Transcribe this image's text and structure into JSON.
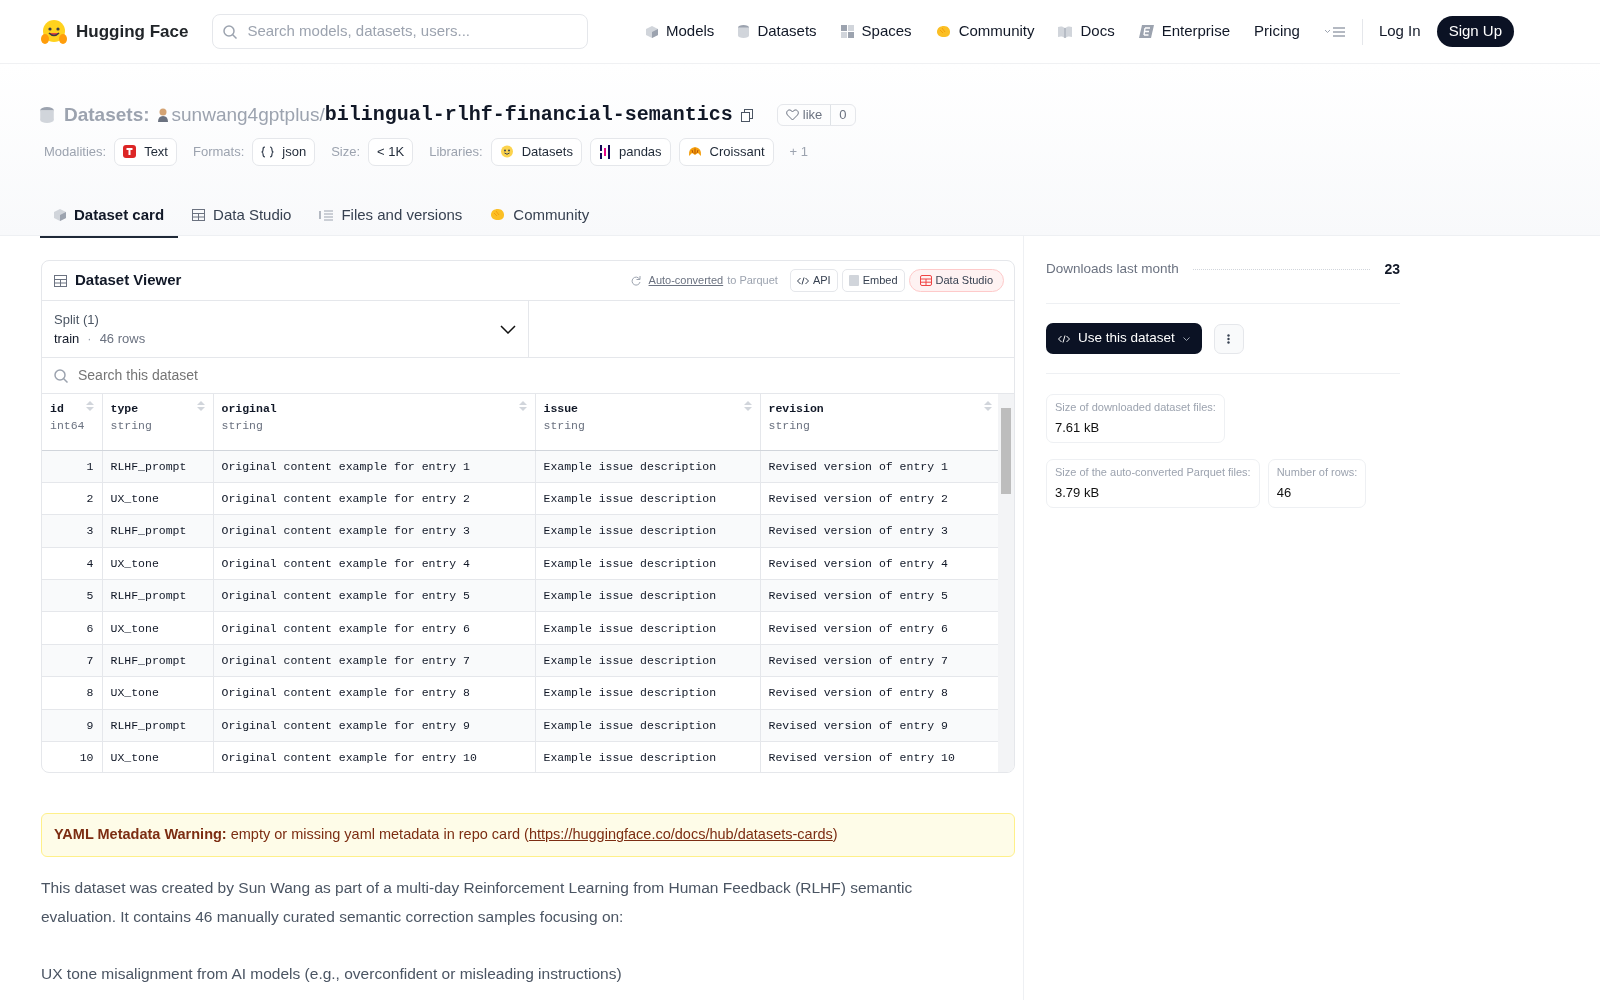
{
  "nav": {
    "brand": "Hugging Face",
    "search_placeholder": "Search models, datasets, users...",
    "links": [
      {
        "label": "Models",
        "kind": "cube"
      },
      {
        "label": "Datasets",
        "kind": "database"
      },
      {
        "label": "Spaces",
        "kind": "grid"
      },
      {
        "label": "Community",
        "kind": "hand"
      },
      {
        "label": "Docs",
        "kind": "book"
      },
      {
        "label": "Enterprise",
        "kind": "enterprise"
      },
      {
        "label": "Pricing",
        "kind": "plain"
      }
    ],
    "login": "Log In",
    "signup": "Sign Up"
  },
  "header": {
    "section": "Datasets:",
    "owner": "sunwang4gptplus",
    "separator": "/",
    "name": "bilingual-rlhf-financial-semantics",
    "like": "like",
    "likes": "0",
    "tag_groups": [
      {
        "label": "Modalities:",
        "tags": [
          {
            "text": "Text",
            "kind": "text"
          }
        ]
      },
      {
        "label": "Formats:",
        "tags": [
          {
            "text": "json",
            "kind": "braces"
          }
        ]
      },
      {
        "label": "Size:",
        "tags": [
          {
            "text": "< 1K",
            "kind": "plain"
          }
        ]
      },
      {
        "label": "Libraries:",
        "tags": [
          {
            "text": "Datasets",
            "kind": "hf"
          },
          {
            "text": "pandas",
            "kind": "pandas"
          },
          {
            "text": "Croissant",
            "kind": "croissant"
          }
        ]
      }
    ],
    "more": "+ 1"
  },
  "tabs": [
    {
      "label": "Dataset card",
      "kind": "cube",
      "selected": true
    },
    {
      "label": "Data Studio",
      "kind": "table",
      "selected": false
    },
    {
      "label": "Files and versions",
      "kind": "files",
      "selected": false
    },
    {
      "label": "Community",
      "kind": "hand",
      "selected": false
    }
  ],
  "viewer": {
    "title": "Dataset Viewer",
    "auto_link": "Auto-converted",
    "auto_rest": "to Parquet",
    "buttons": [
      {
        "label": "API",
        "kind": "api"
      },
      {
        "label": "Embed",
        "kind": "embed"
      },
      {
        "label": "Data Studio",
        "kind": "studio"
      }
    ],
    "split_label": "Split (1)",
    "split_value": "train",
    "split_dot": "·",
    "split_rows": "46 rows",
    "search_placeholder": "Search this dataset",
    "columns": [
      {
        "name": "id",
        "type": "int64"
      },
      {
        "name": "type",
        "type": "string"
      },
      {
        "name": "original",
        "type": "string"
      },
      {
        "name": "issue",
        "type": "string"
      },
      {
        "name": "revision",
        "type": "string"
      }
    ],
    "rows": [
      [
        "1",
        "RLHF_prompt",
        "Original content example for entry 1",
        "Example issue description",
        "Revised version of entry 1"
      ],
      [
        "2",
        "UX_tone",
        "Original content example for entry 2",
        "Example issue description",
        "Revised version of entry 2"
      ],
      [
        "3",
        "RLHF_prompt",
        "Original content example for entry 3",
        "Example issue description",
        "Revised version of entry 3"
      ],
      [
        "4",
        "UX_tone",
        "Original content example for entry 4",
        "Example issue description",
        "Revised version of entry 4"
      ],
      [
        "5",
        "RLHF_prompt",
        "Original content example for entry 5",
        "Example issue description",
        "Revised version of entry 5"
      ],
      [
        "6",
        "UX_tone",
        "Original content example for entry 6",
        "Example issue description",
        "Revised version of entry 6"
      ],
      [
        "7",
        "RLHF_prompt",
        "Original content example for entry 7",
        "Example issue description",
        "Revised version of entry 7"
      ],
      [
        "8",
        "UX_tone",
        "Original content example for entry 8",
        "Example issue description",
        "Revised version of entry 8"
      ],
      [
        "9",
        "RLHF_prompt",
        "Original content example for entry 9",
        "Example issue description",
        "Revised version of entry 9"
      ],
      [
        "10",
        "UX_tone",
        "Original content example for entry 10",
        "Example issue description",
        "Revised version of entry 10"
      ]
    ]
  },
  "warning": {
    "label": "YAML Metadata Warning:",
    "text": "empty or missing yaml metadata in repo card (",
    "link": "https://huggingface.co/docs/hub/datasets-cards",
    "after": ")"
  },
  "paragraphs": [
    "This dataset was created by Sun Wang as part of a multi-day Reinforcement Learning from Human Feedback (RLHF) semantic evaluation. It contains 46 manually curated semantic correction samples focusing on:",
    "UX tone misalignment from AI models (e.g., overconfident or misleading instructions)"
  ],
  "sidebar": {
    "downloads_label": "Downloads last month",
    "downloads": "23",
    "use_button": "Use this dataset",
    "stats": [
      {
        "label": "Size of downloaded dataset files:",
        "value": "7.61 kB"
      },
      {
        "label": "Size of the auto-converted Parquet files:",
        "value": "3.79 kB"
      },
      {
        "label": "Number of rows:",
        "value": "46"
      }
    ]
  }
}
